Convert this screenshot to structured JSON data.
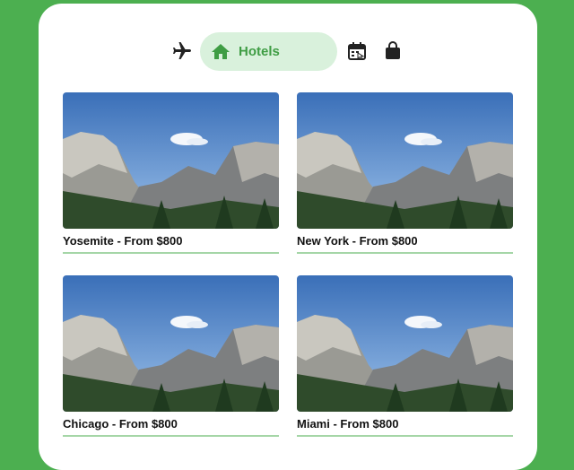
{
  "nav": {
    "flights_icon": "airplane-icon",
    "hotels_icon": "home-icon",
    "hotels_label": "Hotels",
    "calendar_icon": "calendar-icon",
    "bag_icon": "shopping-bag-icon",
    "accent": "#3f9d44",
    "pill_bg": "#d9f1dc"
  },
  "listings": [
    {
      "caption": "Yosemite - From $800"
    },
    {
      "caption": "New York - From $800"
    },
    {
      "caption": "Chicago - From $800"
    },
    {
      "caption": "Miami - From $800"
    }
  ],
  "colors": {
    "background": "#4caf50",
    "card": "#ffffff",
    "underline": "#a5d6a7"
  }
}
